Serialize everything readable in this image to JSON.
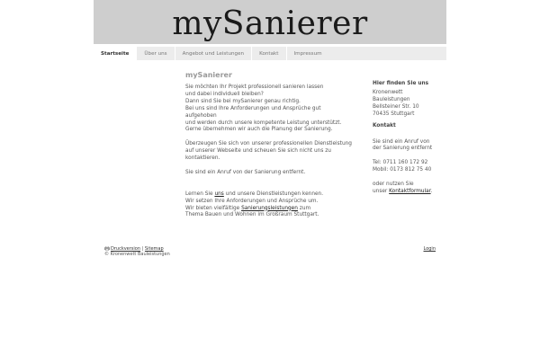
{
  "header": {
    "logo": "mySanierer"
  },
  "nav": [
    {
      "label": "Startseite",
      "active": true
    },
    {
      "label": "Über uns",
      "active": false
    },
    {
      "label": "Angebot und Leistungen",
      "active": false
    },
    {
      "label": "Kontakt",
      "active": false
    },
    {
      "label": "Impressum",
      "active": false
    }
  ],
  "main": {
    "title": "mySanierer",
    "intro": [
      "Sie möchten Ihr Projekt professionell sanieren lassen",
      "und dabei individuell bleiben?",
      "Dann sind Sie bei mySanierer genau richtig.",
      "Bei uns sind Ihre Anforderungen und Ansprüche gut",
      "aufgehoben",
      "und werden durch unsere kompetente Leistung unterstützt.",
      "Gerne übernehmen wir auch die Planung der Sanierung."
    ],
    "convince": [
      "Überzeugen Sie sich von unserer professionellen Dienstleistung",
      "auf unserer Webseite und scheuen Sie sich nicht uns zu",
      "kontaktieren."
    ],
    "call": "Sie sind ein Anruf von der Sanierung entfernt.",
    "learn_prefix": "Lernen Sie ",
    "learn_link": "uns",
    "learn_suffix": " und unsere Dienstleistungen kennen.",
    "learn_line2": "Wir setzen Ihre Anforderungen und Ansprüche um.",
    "offer_prefix": "Wir bieten vielfältige ",
    "offer_link": "Sanierungsleistungen",
    "offer_suffix": " zum",
    "offer_line2": "Thema Bauen und Wohnen im Großraum Stuttgart."
  },
  "side": {
    "find_title": "Hier finden Sie uns",
    "address": [
      "Kronenwett",
      "Bauleistungen",
      "Bellsteiner Str. 10",
      "70435 Stuttgart"
    ],
    "contact_title": "Kontakt",
    "contact_call": [
      "Sie sind ein Anruf von",
      "der Sanierung entfernt"
    ],
    "tel": "Tel: 0711 160 172 92",
    "mobil": "Mobil: 0173 812 75 40",
    "or_line": "oder nutzen Sie",
    "form_prefix": "unser ",
    "form_link": "Kontaktformular",
    "form_suffix": "."
  },
  "footer": {
    "print_link": "Druckversion",
    "separator": " | ",
    "sitemap_link": "Sitemap",
    "copyright": "© Kronenwett Bauleistungen",
    "login_link": "Login"
  }
}
